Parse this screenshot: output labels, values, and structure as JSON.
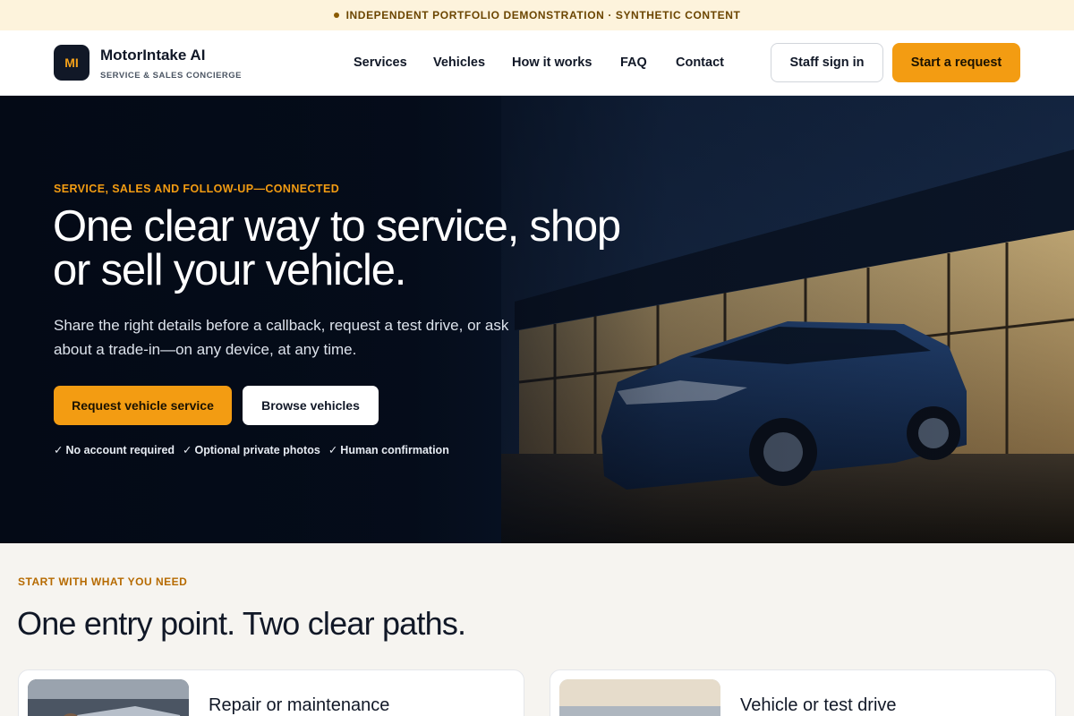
{
  "banner": {
    "text": "INDEPENDENT PORTFOLIO DEMONSTRATION · SYNTHETIC CONTENT"
  },
  "brand": {
    "initials": "MI",
    "name": "MotorIntake AI",
    "tagline": "SERVICE & SALES CONCIERGE"
  },
  "nav": {
    "items": [
      "Services",
      "Vehicles",
      "How it works",
      "FAQ",
      "Contact"
    ]
  },
  "header_actions": {
    "sign_in": "Staff sign in",
    "start": "Start a request"
  },
  "hero": {
    "eyebrow": "SERVICE, SALES AND FOLLOW-UP—CONNECTED",
    "title": "One clear way to service, shop or sell your vehicle.",
    "subtitle": "Share the right details before a callback, request a test drive, or ask about a trade-in—on any device, at any time.",
    "primary_cta": "Request vehicle service",
    "secondary_cta": "Browse vehicles",
    "checks": [
      "No account required",
      "Optional private photos",
      "Human confirmation"
    ]
  },
  "section": {
    "eyebrow": "START WITH WHAT YOU NEED",
    "title": "One entry point. Two clear paths.",
    "cards": [
      {
        "title": "Repair or maintenance"
      },
      {
        "title": "Vehicle or test drive"
      }
    ]
  },
  "colors": {
    "accent": "#f39c12",
    "dark": "#111827",
    "banner_bg": "#fdf3dc"
  },
  "icons": {
    "check": "check-icon"
  }
}
